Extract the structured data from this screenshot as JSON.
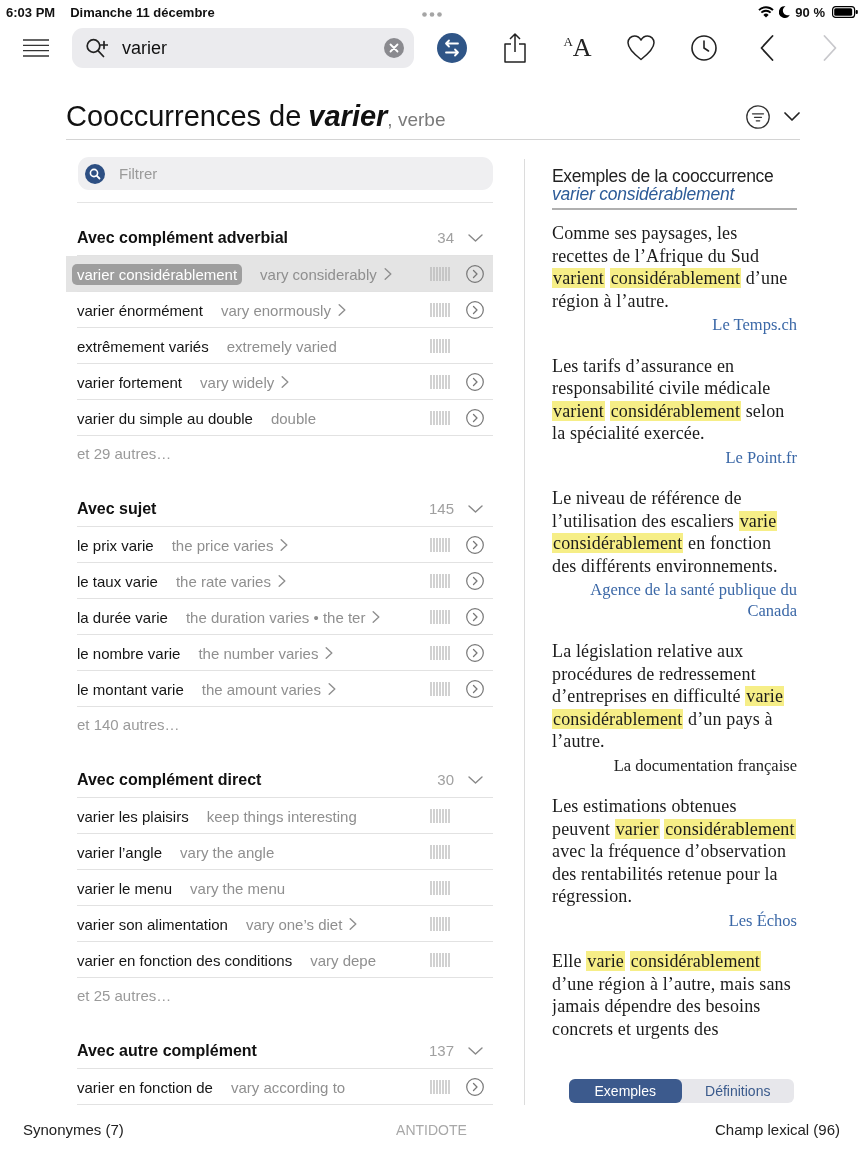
{
  "status_bar": {
    "time": "6:03 PM",
    "date": "Dimanche 11 décembre",
    "battery": "90 %"
  },
  "toolbar": {
    "search": {
      "value": "varier"
    },
    "buttons": [
      {
        "kind": "swap"
      },
      {
        "kind": "share"
      },
      {
        "kind": "text-size",
        "small_letter": "A",
        "large_letter": "A"
      },
      {
        "kind": "favorite"
      },
      {
        "kind": "history"
      },
      {
        "kind": "back",
        "disabled": false
      },
      {
        "kind": "forward",
        "disabled": true
      }
    ]
  },
  "heading": {
    "prefix": "Cooccurrences de",
    "word": "varier",
    "category": ", verbe"
  },
  "filter": {
    "placeholder": "Filtrer"
  },
  "sections": [
    {
      "title": "Avec complément adverbial",
      "count": "34",
      "rows": [
        {
          "term": "varier considérablement",
          "translation": "vary considerably",
          "has_more": true,
          "has_details": true,
          "selected": true
        },
        {
          "term": "varier énormément",
          "translation": "vary enormously",
          "has_more": true,
          "has_details": true,
          "selected": false
        },
        {
          "term": "extrêmement variés",
          "translation": "extremely varied",
          "has_more": false,
          "has_details": false,
          "selected": false
        },
        {
          "term": "varier fortement",
          "translation": "vary widely",
          "has_more": true,
          "has_details": true,
          "selected": false
        },
        {
          "term": "varier du simple au double",
          "translation": "double",
          "has_more": false,
          "has_details": true,
          "selected": false
        }
      ],
      "more": "et 29 autres…"
    },
    {
      "title": "Avec sujet",
      "count": "145",
      "rows": [
        {
          "term": "le prix varie",
          "translation": "the price varies",
          "has_more": true,
          "has_details": true,
          "selected": false
        },
        {
          "term": "le taux varie",
          "translation": "the rate varies",
          "has_more": true,
          "has_details": true,
          "selected": false
        },
        {
          "term": "la durée varie",
          "translation": "the duration varies • the ter",
          "has_more": true,
          "has_details": true,
          "selected": false
        },
        {
          "term": "le nombre varie",
          "translation": "the number varies",
          "has_more": true,
          "has_details": true,
          "selected": false
        },
        {
          "term": "le montant varie",
          "translation": "the amount varies",
          "has_more": true,
          "has_details": true,
          "selected": false
        }
      ],
      "more": "et 140 autres…"
    },
    {
      "title": "Avec complément direct",
      "count": "30",
      "rows": [
        {
          "term": "varier les plaisirs",
          "translation": "keep things interesting",
          "has_more": false,
          "has_details": false,
          "selected": false
        },
        {
          "term": "varier l’angle",
          "translation": "vary the angle",
          "has_more": false,
          "has_details": false,
          "selected": false
        },
        {
          "term": "varier le menu",
          "translation": "vary the menu",
          "has_more": false,
          "has_details": false,
          "selected": false
        },
        {
          "term": "varier son alimentation",
          "translation": "vary one’s diet",
          "has_more": true,
          "has_details": false,
          "selected": false
        },
        {
          "term": "varier en fonction des conditions",
          "translation": "vary depe",
          "has_more": false,
          "has_details": false,
          "selected": false
        }
      ],
      "more": "et 25 autres…"
    },
    {
      "title": "Avec autre complément",
      "count": "137",
      "rows": [
        {
          "term": "varier en fonction de",
          "translation": "vary according to",
          "has_more": false,
          "has_details": true,
          "selected": false
        }
      ]
    }
  ],
  "examples": {
    "heading": "Exemples de la cooccurrence",
    "term": "varier considérablement",
    "items": [
      {
        "parts": [
          {
            "text": "Comme ses paysages, les recettes de l’Afrique du Sud ",
            "highlight": false
          },
          {
            "text": "varient considérablement",
            "highlight": true
          },
          {
            "text": " d’une région à l’autre.",
            "highlight": false
          }
        ],
        "source": "Le Temps.ch",
        "linked": true
      },
      {
        "parts": [
          {
            "text": "Les tarifs d’assurance en responsabilité civile médicale ",
            "highlight": false
          },
          {
            "text": "varient considérablement",
            "highlight": true
          },
          {
            "text": " selon la spécialité exercée.",
            "highlight": false
          }
        ],
        "source": "Le Point.fr",
        "linked": true
      },
      {
        "parts": [
          {
            "text": "Le niveau de référence de l’utilisation des escaliers ",
            "highlight": false
          },
          {
            "text": "varie considérablement",
            "highlight": true
          },
          {
            "text": " en fonction des différents environnements.",
            "highlight": false
          }
        ],
        "source": "Agence de la santé publique du Canada",
        "linked": true
      },
      {
        "parts": [
          {
            "text": "La législation relative aux procédures de redressement d’entreprises en difficulté ",
            "highlight": false
          },
          {
            "text": "varie considérablement",
            "highlight": true
          },
          {
            "text": " d’un pays à l’autre.",
            "highlight": false
          }
        ],
        "source": "La documentation française",
        "linked": false
      },
      {
        "parts": [
          {
            "text": "Les estimations obtenues peuvent ",
            "highlight": false
          },
          {
            "text": "varier considérablement",
            "highlight": true
          },
          {
            "text": " avec la fréquence d’observation des rentabilités retenue pour la régression.",
            "highlight": false
          }
        ],
        "source": "Les Échos",
        "linked": true
      },
      {
        "parts": [
          {
            "text": "Elle ",
            "highlight": false
          },
          {
            "text": "varie considérablement",
            "highlight": true
          },
          {
            "text": " d’une région à l’autre, mais sans jamais dépendre des besoins concrets et urgents des",
            "highlight": false
          }
        ]
      }
    ]
  },
  "view_tabs": [
    {
      "label": "Exemples",
      "selected": true
    },
    {
      "label": "Définitions",
      "selected": false
    }
  ],
  "footer": {
    "left": "Synonymes (7)",
    "center": "ANTIDOTE",
    "right": "Champ lexical (96)"
  }
}
